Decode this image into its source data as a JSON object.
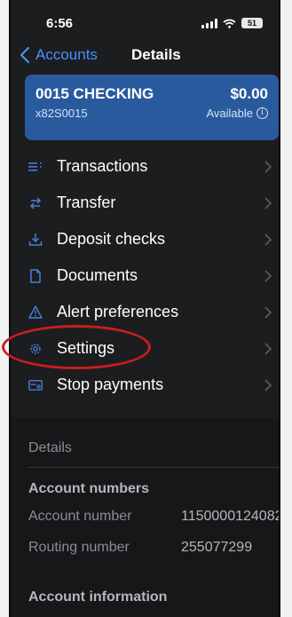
{
  "status_bar": {
    "time": "6:56",
    "battery": "51"
  },
  "nav": {
    "back_label": "Accounts",
    "title": "Details"
  },
  "account": {
    "name": "0015 CHECKING",
    "number": "x82S0015",
    "balance": "$0.00",
    "available_label": "Available"
  },
  "menu": {
    "items": [
      {
        "label": "Transactions",
        "icon": "list-icon"
      },
      {
        "label": "Transfer",
        "icon": "transfer-arrows-icon"
      },
      {
        "label": "Deposit checks",
        "icon": "download-tray-icon"
      },
      {
        "label": "Documents",
        "icon": "document-icon"
      },
      {
        "label": "Alert preferences",
        "icon": "warning-triangle-icon"
      },
      {
        "label": "Settings",
        "icon": "gear-icon"
      },
      {
        "label": "Stop payments",
        "icon": "check-card-icon"
      }
    ]
  },
  "details": {
    "section_title": "Details",
    "account_numbers_title": "Account numbers",
    "account_number_label": "Account number",
    "account_number_value": "1150000124082",
    "routing_number_label": "Routing number",
    "routing_number_value": "255077299",
    "account_information_title": "Account information"
  },
  "colors": {
    "background": "#1c1d1f",
    "card": "#2a5a9e",
    "accent": "#4a90ff",
    "highlight": "#c81e1e"
  }
}
